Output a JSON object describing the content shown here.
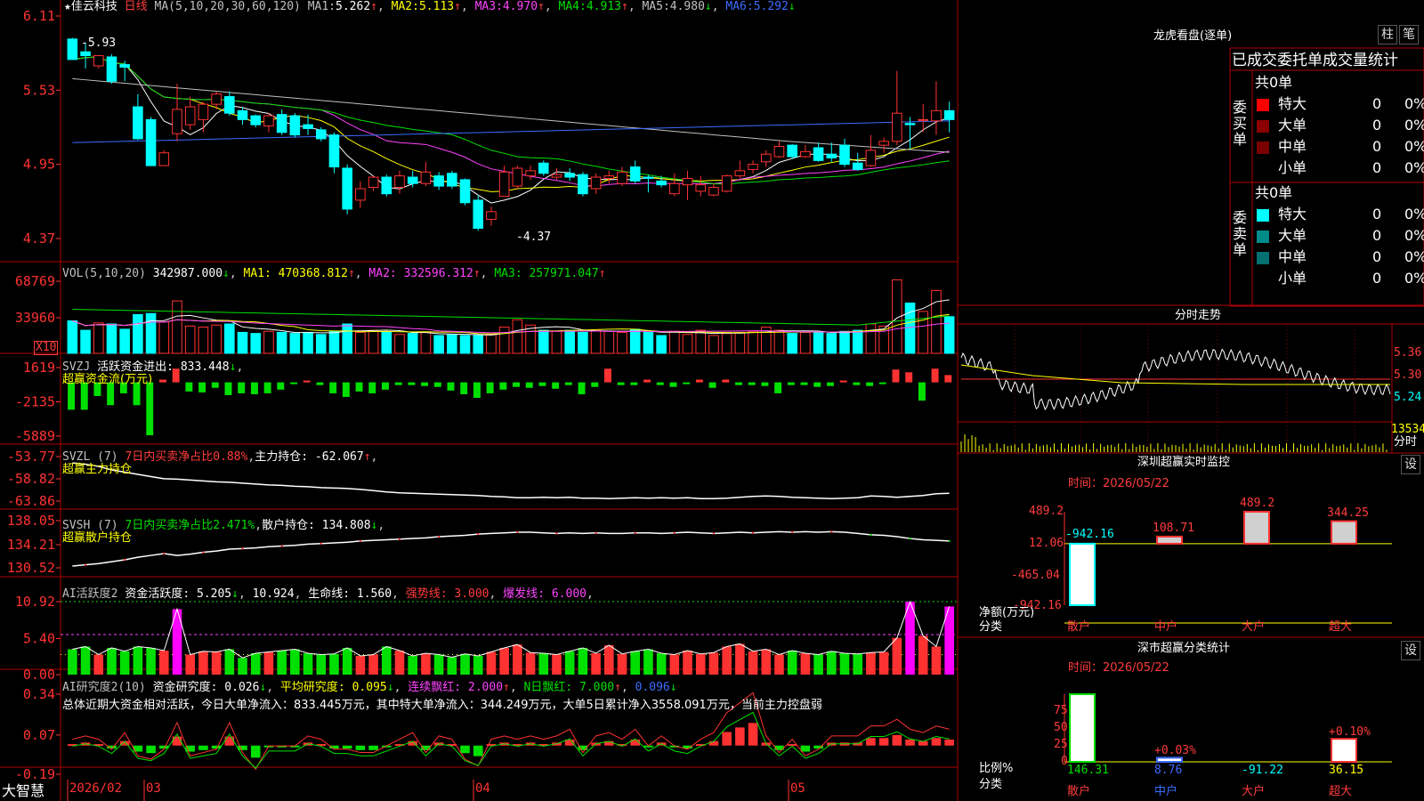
{
  "chart_data": [
    {
      "type": "candlestick",
      "stock_name": "佳云科技",
      "period": "日线",
      "title": "MA(5,10,20,30,60,120)",
      "ma": [
        {
          "name": "MA1",
          "value": "5.262",
          "arrow": "↑"
        },
        {
          "name": "MA2",
          "value": "5.113",
          "arrow": "↑"
        },
        {
          "name": "MA3",
          "value": "4.970",
          "arrow": "↑"
        },
        {
          "name": "MA4",
          "value": "4.913",
          "arrow": "↑"
        },
        {
          "name": "MA5",
          "value": "4.980",
          "arrow": "↓"
        },
        {
          "name": "MA6",
          "value": "5.292",
          "arrow": "↓"
        }
      ],
      "y_ticks": [
        "6.11",
        "5.53",
        "4.95",
        "4.37"
      ],
      "ylim": [
        4.37,
        6.11
      ],
      "high_label": "5.93",
      "low_label": "4.37",
      "x_labels": [
        "2026/02",
        "03",
        "04",
        "05"
      ],
      "candles": [
        [
          5.93,
          5.77,
          5.94,
          5.77
        ],
        [
          5.83,
          5.8,
          5.9,
          5.7
        ],
        [
          5.72,
          5.8,
          5.8,
          5.7
        ],
        [
          5.79,
          5.6,
          5.81,
          5.58
        ],
        [
          5.73,
          5.71,
          5.76,
          5.6
        ],
        [
          5.4,
          5.15,
          5.5,
          5.14
        ],
        [
          5.3,
          4.94,
          5.32,
          4.94
        ],
        [
          4.94,
          5.04,
          5.06,
          4.94
        ],
        [
          5.19,
          5.38,
          5.58,
          5.13
        ],
        [
          5.26,
          5.4,
          5.48,
          5.22
        ],
        [
          5.3,
          5.42,
          5.44,
          5.2
        ],
        [
          5.42,
          5.5,
          5.52,
          5.38
        ],
        [
          5.48,
          5.35,
          5.52,
          5.33
        ],
        [
          5.37,
          5.3,
          5.4,
          5.26
        ],
        [
          5.33,
          5.26,
          5.34,
          5.24
        ],
        [
          5.25,
          5.33,
          5.35,
          5.2
        ],
        [
          5.34,
          5.2,
          5.38,
          5.18
        ],
        [
          5.33,
          5.18,
          5.35,
          5.16
        ],
        [
          5.26,
          5.23,
          5.34,
          5.18
        ],
        [
          5.22,
          5.15,
          5.24,
          5.13
        ],
        [
          5.18,
          4.93,
          5.2,
          4.88
        ],
        [
          4.92,
          4.6,
          4.95,
          4.56
        ],
        [
          4.67,
          4.76,
          4.82,
          4.61
        ],
        [
          4.77,
          4.85,
          4.86,
          4.74
        ],
        [
          4.85,
          4.72,
          4.87,
          4.7
        ],
        [
          4.77,
          4.86,
          4.9,
          4.72
        ],
        [
          4.85,
          4.8,
          4.9,
          4.77
        ],
        [
          4.8,
          4.89,
          4.97,
          4.78
        ],
        [
          4.86,
          4.78,
          4.89,
          4.75
        ],
        [
          4.88,
          4.78,
          4.9,
          4.76
        ],
        [
          4.83,
          4.65,
          4.84,
          4.63
        ],
        [
          4.67,
          4.45,
          4.71,
          4.43
        ],
        [
          4.52,
          4.58,
          4.62,
          4.47
        ],
        [
          4.7,
          4.89,
          4.94,
          4.72
        ],
        [
          4.78,
          4.92,
          4.94,
          4.76
        ],
        [
          4.86,
          4.9,
          4.94,
          4.83
        ],
        [
          4.96,
          4.88,
          4.98,
          4.86
        ],
        [
          4.85,
          4.87,
          4.92,
          4.83
        ],
        [
          4.88,
          4.85,
          4.92,
          4.82
        ],
        [
          4.87,
          4.72,
          4.89,
          4.7
        ],
        [
          4.76,
          4.85,
          4.88,
          4.72
        ],
        [
          4.84,
          4.86,
          4.9,
          4.8
        ],
        [
          4.8,
          4.89,
          4.93,
          4.78
        ],
        [
          4.93,
          4.82,
          4.98,
          4.8
        ],
        [
          4.85,
          4.84,
          4.87,
          4.73
        ],
        [
          4.82,
          4.79,
          4.86,
          4.77
        ],
        [
          4.72,
          4.8,
          4.88,
          4.7
        ],
        [
          4.79,
          4.84,
          4.9,
          4.67
        ],
        [
          4.74,
          4.79,
          4.86,
          4.7
        ],
        [
          4.71,
          4.77,
          4.8,
          4.7
        ],
        [
          4.74,
          4.86,
          4.87,
          4.73
        ],
        [
          4.86,
          4.9,
          4.98,
          4.84
        ],
        [
          4.91,
          4.95,
          4.98,
          4.88
        ],
        [
          4.97,
          5.03,
          5.06,
          4.93
        ],
        [
          5.01,
          5.09,
          5.13,
          5.0
        ],
        [
          5.1,
          5.01,
          5.11,
          4.99
        ],
        [
          5.01,
          5.05,
          5.1,
          5.0
        ],
        [
          5.08,
          4.98,
          5.12,
          4.97
        ],
        [
          5.03,
          5.0,
          5.12,
          4.97
        ],
        [
          5.1,
          4.95,
          5.15,
          4.93
        ],
        [
          4.96,
          4.91,
          5.04,
          4.9
        ],
        [
          4.94,
          5.06,
          5.18,
          4.93
        ],
        [
          5.1,
          5.13,
          5.16,
          5.04
        ],
        [
          5.13,
          5.35,
          5.68,
          5.1
        ],
        [
          5.27,
          5.26,
          5.32,
          5.07
        ],
        [
          5.3,
          5.3,
          5.42,
          5.2
        ],
        [
          5.29,
          5.37,
          5.6,
          5.18
        ],
        [
          5.37,
          5.3,
          5.44,
          5.2
        ]
      ]
    },
    {
      "type": "bar",
      "title": "VOL(5,10,20)",
      "value": "342987.000",
      "value_arrow": "↓",
      "ma": [
        {
          "name": "MA1",
          "value": "470368.812",
          "arrow": "↑"
        },
        {
          "name": "MA2",
          "value": "332596.312",
          "arrow": "↑"
        },
        {
          "name": "MA3",
          "value": "257971.047",
          "arrow": "↑"
        }
      ],
      "y_ticks": [
        "68769",
        "33960"
      ],
      "unit": "X10",
      "ylim": [
        0,
        68769
      ],
      "values": [
        31000,
        22000,
        29000,
        28000,
        23000,
        37000,
        38000,
        30000,
        50000,
        26000,
        25000,
        27000,
        28000,
        20000,
        19000,
        21000,
        20000,
        19000,
        20000,
        18000,
        21000,
        28000,
        20000,
        22000,
        20000,
        18000,
        19000,
        20000,
        17000,
        18000,
        17000,
        17000,
        18000,
        25000,
        32000,
        27000,
        22000,
        21000,
        22000,
        20000,
        22000,
        21000,
        20000,
        23000,
        20000,
        17000,
        21000,
        18000,
        22000,
        17000,
        19000,
        20000,
        21000,
        25000,
        22000,
        19000,
        20000,
        20000,
        19000,
        21000,
        22000,
        28000,
        26000,
        72000,
        48000,
        40000,
        60000,
        35000
      ]
    },
    {
      "type": "bar",
      "title": "SVZJ",
      "label": "活跃资金进出",
      "value": "833.448",
      "value_arrow": "↓",
      "subtitle": "超赢资金流(万元)",
      "y_ticks": [
        "1619",
        "-2135",
        "-5889"
      ],
      "ylim": [
        -5889,
        1619
      ],
      "values": [
        -3000,
        -3000,
        -1500,
        -2500,
        -1200,
        -2500,
        -5800,
        300,
        1500,
        -1000,
        -1100,
        -600,
        -1400,
        -1200,
        -1300,
        -1200,
        -800,
        -200,
        200,
        -300,
        -1200,
        -1600,
        -1000,
        -1200,
        -800,
        -300,
        -300,
        -400,
        -500,
        -900,
        -1300,
        -1700,
        -1200,
        -800,
        -500,
        -600,
        -400,
        -700,
        -300,
        -1300,
        -500,
        1500,
        -300,
        -300,
        300,
        -300,
        -500,
        -200,
        300,
        -600,
        300,
        -300,
        -300,
        -400,
        -1200,
        -300,
        -300,
        -500,
        -400,
        200,
        -300,
        -400,
        -200,
        1400,
        1100,
        -2000,
        1500,
        800
      ]
    },
    {
      "type": "line",
      "title": "SVZL (7)",
      "label": "7日内买卖净占比",
      "label_value": "0.88%",
      "holding_label": "主力持仓",
      "value": "-62.067",
      "value_arrow": "↑",
      "subtitle": "超赢主力持仓",
      "y_ticks": [
        "-53.77",
        "-58.82",
        "-63.86"
      ],
      "ylim": [
        -63.86,
        -53.77
      ],
      "values": [
        -55.2,
        -55.5,
        -56.0,
        -56.8,
        -57.3,
        -57.8,
        -58.3,
        -58.8,
        -58.9,
        -59.1,
        -59.3,
        -59.5,
        -59.6,
        -59.8,
        -60.0,
        -60.2,
        -60.3,
        -60.5,
        -60.6,
        -60.8,
        -60.9,
        -61.0,
        -61.2,
        -61.5,
        -61.8,
        -62.0,
        -62.1,
        -62.2,
        -62.3,
        -62.4,
        -62.5,
        -62.6,
        -62.8,
        -62.9,
        -63.1,
        -63.1,
        -63.0,
        -63.1,
        -63.0,
        -63.2,
        -63.2,
        -63.3,
        -63.2,
        -63.1,
        -63.2,
        -63.1,
        -63.2,
        -63.1,
        -63.3,
        -63.3,
        -63.2,
        -63.0,
        -62.8,
        -62.7,
        -62.8,
        -63.0,
        -63.1,
        -63.2,
        -63.3,
        -63.2,
        -63.1,
        -62.7,
        -62.8,
        -63.0,
        -62.8,
        -62.6,
        -62.2,
        -62.1
      ]
    },
    {
      "type": "line",
      "title": "SVSH (7)",
      "label": "7日内买卖净占比",
      "label_value": "2.471%",
      "holding_label": "散户持仓",
      "value": "134.808",
      "value_arrow": "↓",
      "subtitle": "超赢散户持仓",
      "y_ticks": [
        "138.05",
        "134.21",
        "130.52"
      ],
      "ylim": [
        130.52,
        138.05
      ],
      "values": [
        130.8,
        131.0,
        131.2,
        131.5,
        131.8,
        132.2,
        132.5,
        132.8,
        132.5,
        132.7,
        133.0,
        133.2,
        133.5,
        133.6,
        133.7,
        133.9,
        134.0,
        134.1,
        134.3,
        134.4,
        134.5,
        134.6,
        134.8,
        134.9,
        135.0,
        135.1,
        135.2,
        135.3,
        135.5,
        135.6,
        135.7,
        135.9,
        136.0,
        136.1,
        136.2,
        136.2,
        136.1,
        136.0,
        136.1,
        136.0,
        136.1,
        136.0,
        136.0,
        136.1,
        136.1,
        136.0,
        136.1,
        136.2,
        136.1,
        136.0,
        136.1,
        136.2,
        136.1,
        136.2,
        136.3,
        136.2,
        136.3,
        136.2,
        136.3,
        136.2,
        136.0,
        135.8,
        135.7,
        135.5,
        135.2,
        135.0,
        134.9,
        134.8
      ]
    },
    {
      "type": "bar",
      "title": "AI活跃度2",
      "label": "资金活跃度",
      "value": "5.205",
      "value_arrow": "↓",
      "extra": "10.924",
      "life_label": "生命线",
      "life_value": "1.560",
      "strong_label": "强势线",
      "strong_value": "3.000",
      "burst_label": "爆发线",
      "burst_value": "6.000",
      "y_ticks": [
        "10.92",
        "5.40",
        "0.00"
      ],
      "ylim": [
        0,
        10.92
      ],
      "values": [
        3.8,
        4.2,
        3.0,
        4.0,
        3.5,
        4.2,
        4.0,
        3.6,
        9.8,
        3.0,
        3.5,
        3.4,
        3.8,
        2.5,
        3.2,
        3.4,
        3.6,
        3.8,
        3.2,
        3.0,
        3.1,
        4.0,
        2.8,
        3.0,
        4.2,
        3.6,
        2.8,
        3.2,
        3.0,
        2.6,
        3.1,
        2.8,
        3.4,
        4.0,
        4.5,
        3.3,
        3.2,
        3.0,
        3.5,
        4.0,
        3.2,
        4.4,
        3.1,
        3.5,
        3.8,
        3.2,
        3.0,
        3.6,
        3.1,
        3.3,
        4.2,
        4.6,
        3.5,
        3.8,
        3.0,
        3.6,
        3.2,
        3.0,
        3.5,
        3.2,
        3.1,
        3.3,
        3.4,
        5.5,
        10.9,
        5.8,
        4.2,
        10.2,
        5.2
      ],
      "colors": "mixed red/green/magenta"
    },
    {
      "type": "bar",
      "title": "AI研究度2(10)",
      "label": "资金研究度",
      "value": "0.026",
      "value_arrow": "↓",
      "avg_label": "平均研究度",
      "avg_value": "0.095",
      "avg_arrow": "↓",
      "red_label": "连续飘红",
      "red_value": "2.000",
      "red_arrow": "↑",
      "nred_label": "N日飘红",
      "nred_value": "7.000",
      "nred_arrow": "↑",
      "last_value": "0.096",
      "last_arrow": "↓",
      "y_ticks": [
        "0.34",
        "0.07",
        "-0.19"
      ],
      "ylim": [
        -0.19,
        0.34
      ],
      "comment": "总体近期大资金相对活跃，今日大单净流入：833.445万元，其中特大单净流入：344.249万元，大单5日累计净入3558.091万元，当前主力控盘弱",
      "values": [
        0.01,
        0.02,
        0.01,
        -0.02,
        0.03,
        -0.04,
        -0.05,
        -0.02,
        0.06,
        -0.04,
        -0.03,
        -0.02,
        0.06,
        -0.03,
        -0.08,
        -0.01,
        -0.01,
        -0.01,
        0.02,
        0.01,
        -0.02,
        -0.02,
        -0.03,
        -0.03,
        -0.01,
        0.01,
        0.03,
        -0.03,
        0.02,
        0.01,
        -0.05,
        -0.07,
        0.01,
        0.02,
        0.01,
        0.02,
        0.01,
        0.02,
        0.04,
        -0.03,
        0.02,
        0.03,
        0.01,
        0.04,
        -0.01,
        0.02,
        -0.01,
        -0.02,
        0.01,
        0.03,
        0.09,
        0.12,
        0.15,
        0.02,
        -0.03,
        0.01,
        -0.04,
        -0.02,
        0.02,
        0.02,
        0.02,
        0.05,
        0.05,
        0.07,
        0.04,
        0.03,
        0.05,
        0.04
      ]
    }
  ],
  "logo": "大智慧",
  "right_panel": {
    "dragon": {
      "title": "龙虎看盘(逐单)",
      "btn1": "柱",
      "btn2": "笔",
      "header": "已成交委托单成交量统计",
      "buy": {
        "side_label": "委买单",
        "total": "共0单",
        "rows": [
          {
            "label": "特大",
            "count": "0",
            "pct": "0%",
            "color": "#ff0000"
          },
          {
            "label": "大单",
            "count": "0",
            "pct": "0%",
            "color": "#8b0000"
          },
          {
            "label": "中单",
            "count": "0",
            "pct": "0%",
            "color": "#7a0000"
          },
          {
            "label": "小单",
            "count": "0",
            "pct": "0%",
            "color": ""
          }
        ]
      },
      "sell": {
        "side_label": "委卖单",
        "total": "共0单",
        "rows": [
          {
            "label": "特大",
            "count": "0",
            "pct": "0%",
            "color": "#00ffff"
          },
          {
            "label": "大单",
            "count": "0",
            "pct": "0%",
            "color": "#008b8b"
          },
          {
            "label": "中单",
            "count": "0",
            "pct": "0%",
            "color": "#007070"
          },
          {
            "label": "小单",
            "count": "0",
            "pct": "0%",
            "color": ""
          }
        ]
      }
    },
    "intraday": {
      "title": "分时走势",
      "y_ticks": [
        "5.36",
        "5.30",
        "5.24"
      ],
      "vol_label": "13534",
      "unit": "分时",
      "ylim": [
        5.2,
        5.4
      ]
    },
    "monitor": {
      "title": "深圳超赢实时监控",
      "btn": "设",
      "time_label": "时间：",
      "time": "2026/05/22",
      "y_ticks": [
        "489.2",
        "12.06",
        "-465.04",
        "-942.16"
      ],
      "axis_label": "净额(万元)",
      "axis_label2": "分类",
      "chart_data": {
        "type": "bar",
        "categories": [
          "散户",
          "中户",
          "大户",
          "超大"
        ],
        "values": [
          -942.16,
          108.71,
          489.2,
          344.25
        ],
        "ylim": [
          -942.16,
          489.2
        ]
      }
    },
    "classify": {
      "title": "深市超赢分类统计",
      "btn": "设",
      "time_label": "时间：",
      "time": "2026/05/22",
      "y_ticks": [
        "75",
        "50",
        "25",
        "0"
      ],
      "axis_label": "比例%",
      "axis_label2": "分类",
      "chart_data": {
        "type": "bar",
        "categories": [
          "散户",
          "中户",
          "大户",
          "超大"
        ],
        "values": [
          146.31,
          8.76,
          -91.22,
          36.15
        ],
        "bar_labels": [
          "",
          "+0.03%",
          "",
          "+0.10%"
        ]
      }
    }
  }
}
